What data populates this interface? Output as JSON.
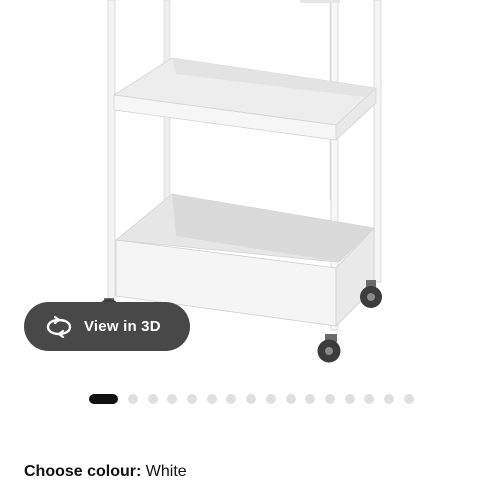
{
  "viewer": {
    "view_3d_label": "View in 3D",
    "icon": "rotate-360-icon"
  },
  "carousel": {
    "dot_count": 16,
    "active_index": 0
  },
  "colour": {
    "label": "Choose colour:",
    "value": "White"
  },
  "colors": {
    "button_bg": "#484848",
    "active_dot": "#111111",
    "inactive_dot": "#dfdfdf",
    "product": "#f3f3f3"
  }
}
